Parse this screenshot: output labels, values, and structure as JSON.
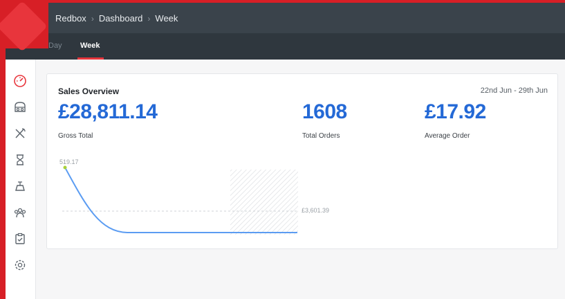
{
  "breadcrumb": [
    "Redbox",
    "Dashboard",
    "Week"
  ],
  "tabs": {
    "day": "Day",
    "week": "Week"
  },
  "sidebar": {
    "icons": [
      "dashboard-icon",
      "store-icon",
      "utensils-icon",
      "hourglass-icon",
      "scale-icon",
      "team-icon",
      "clipboard-check-icon",
      "settings-icon"
    ]
  },
  "overview": {
    "title": "Sales Overview",
    "date_range": "22nd Jun - 29th Jun",
    "gross_total": "£28,811.14",
    "gross_total_label": "Gross Total",
    "total_orders": "1608",
    "total_orders_label": "Total Orders",
    "average_order": "£17.92",
    "average_order_label": "Average Order"
  },
  "chart_data": {
    "type": "line",
    "max_label": "519.17",
    "avg_label": "£3,601.39",
    "colors": {
      "line": "#5b9cf2",
      "point": "#a8d13a"
    }
  },
  "colors": {
    "brand_red": "#d71f26",
    "accent_blue": "#2469d6",
    "topbar": "#3a434b"
  }
}
